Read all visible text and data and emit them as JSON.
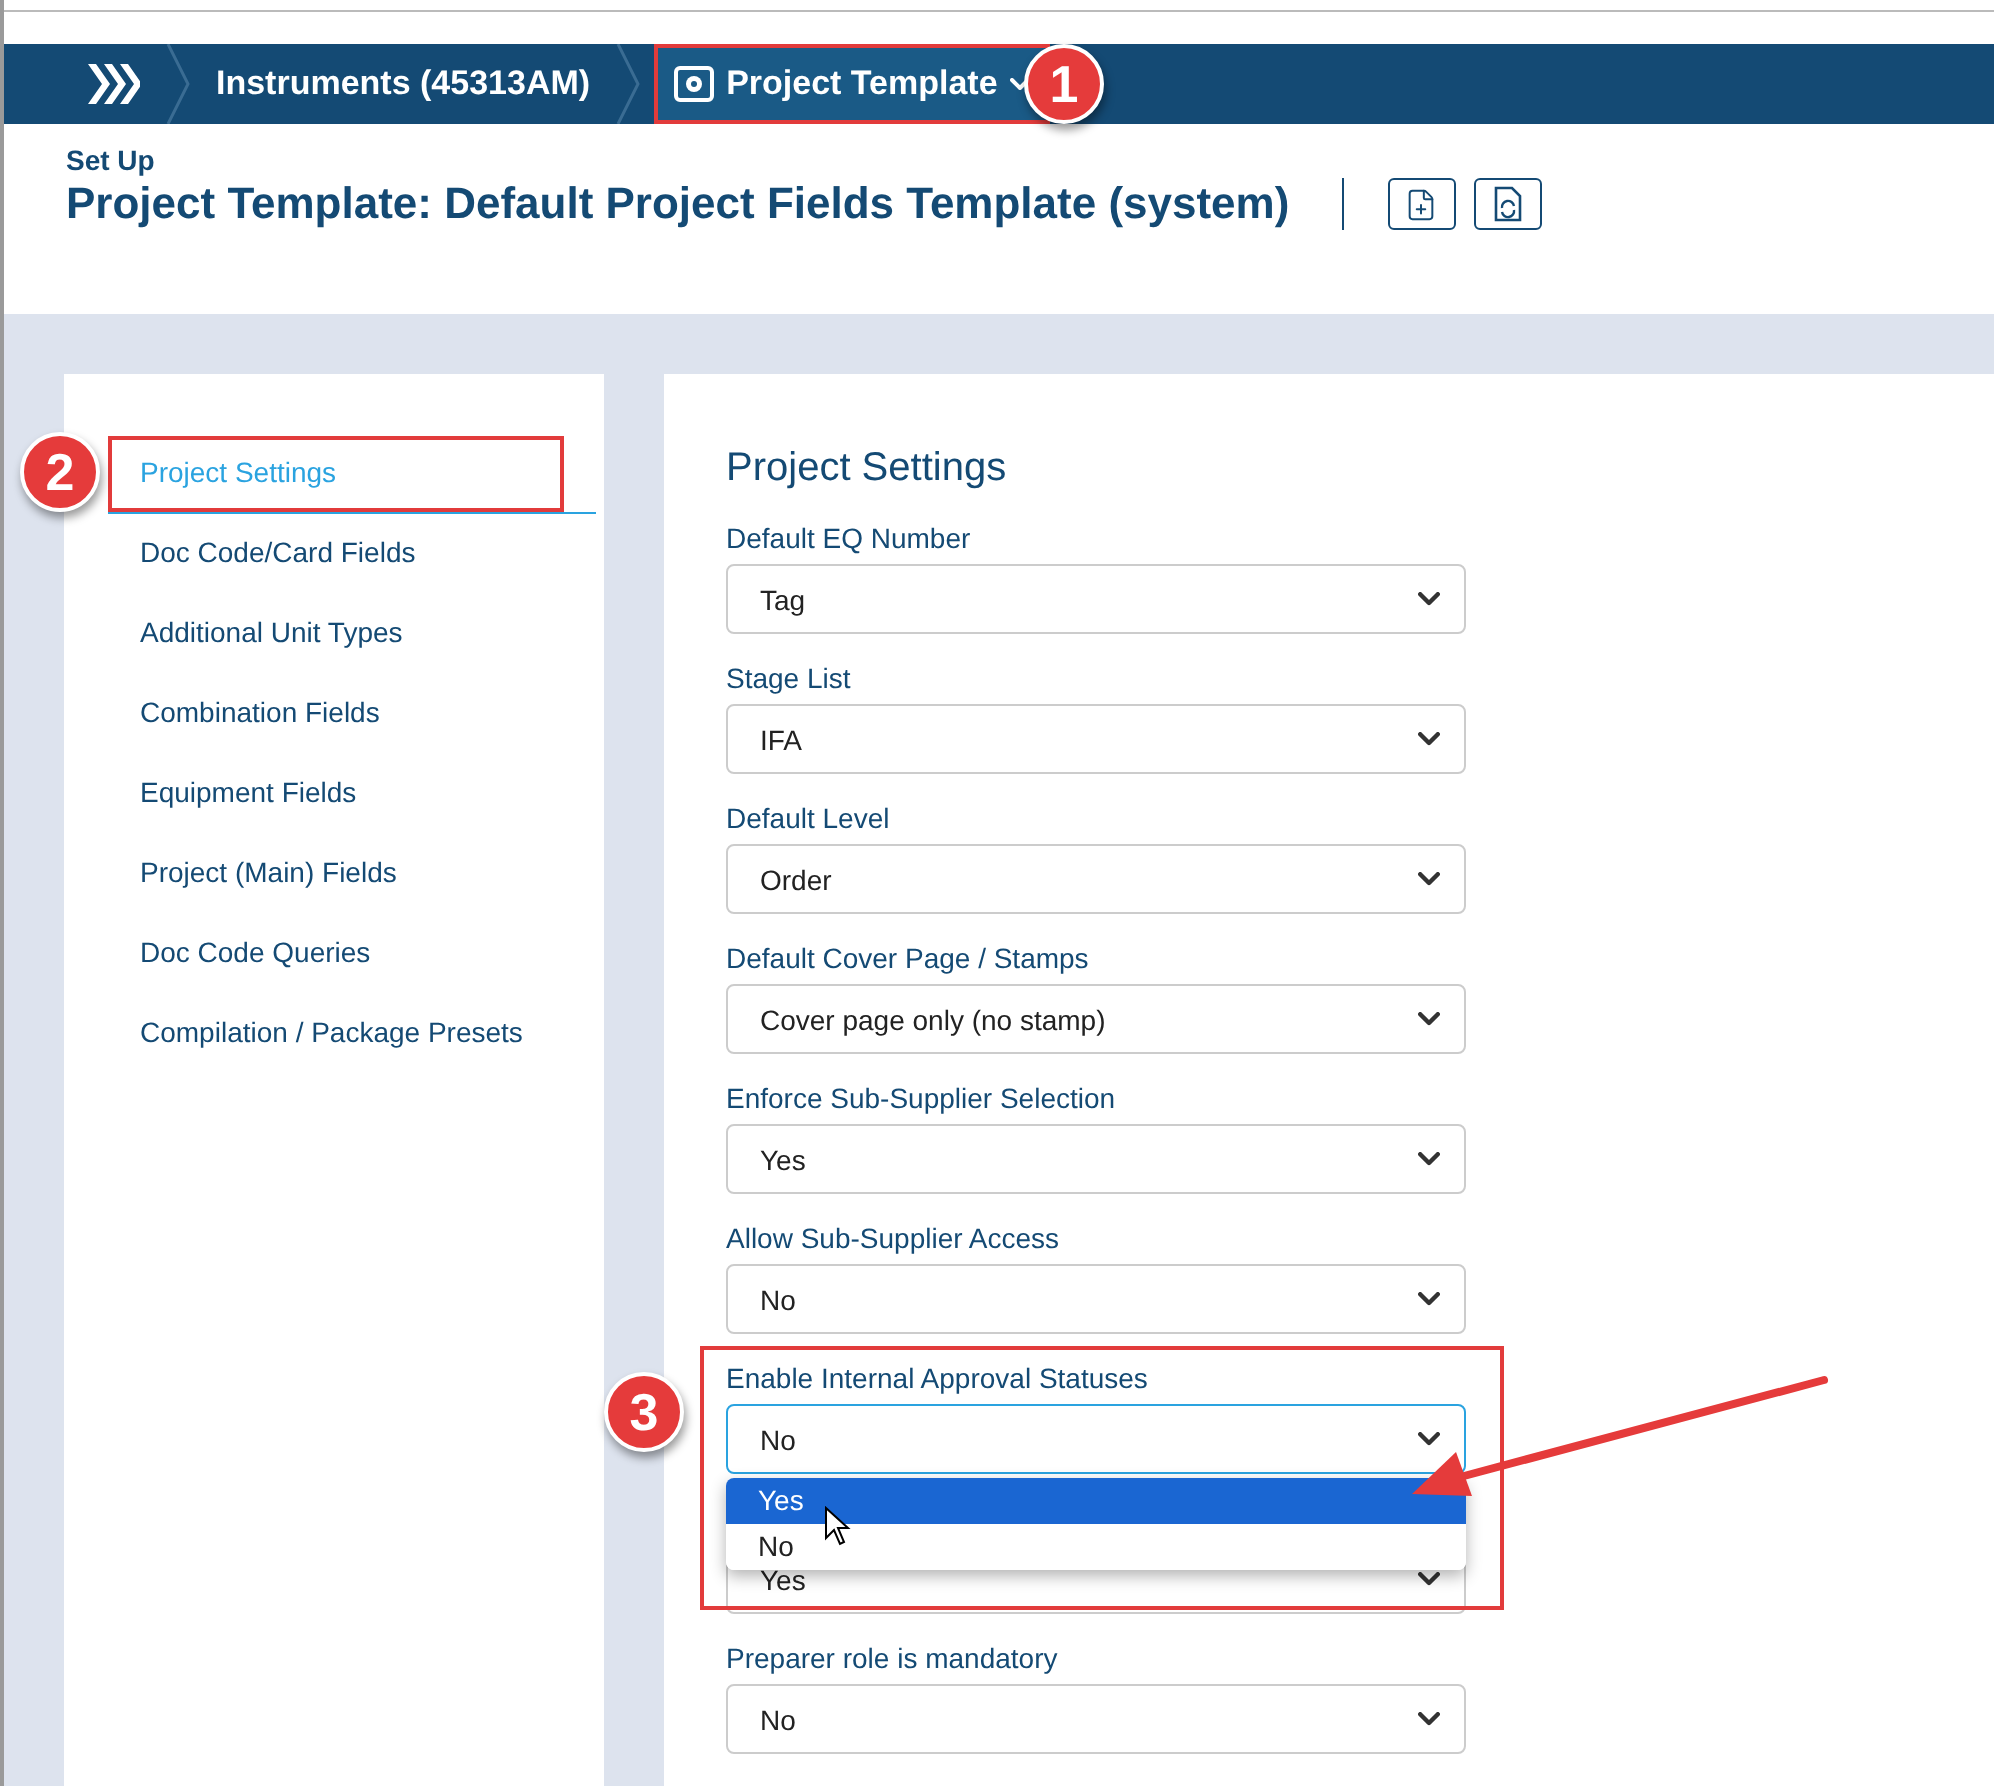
{
  "nav": {
    "crumbs": [
      {
        "kind": "home"
      },
      {
        "kind": "link",
        "label": "Instruments (45313AM)"
      },
      {
        "kind": "dropdown",
        "label": "Project Template"
      }
    ]
  },
  "header": {
    "section": "Set Up",
    "title": "Project Template: Default Project Fields Template (system)",
    "actions": [
      {
        "kind": "add"
      },
      {
        "kind": "refresh"
      }
    ]
  },
  "sidebar": {
    "items": [
      {
        "label": "Project Settings",
        "selected": true
      },
      {
        "label": "Doc Code/Card Fields",
        "selected": false
      },
      {
        "label": "Additional Unit Types",
        "selected": false
      },
      {
        "label": "Combination Fields",
        "selected": false
      },
      {
        "label": "Equipment Fields",
        "selected": false
      },
      {
        "label": "Project (Main) Fields",
        "selected": false
      },
      {
        "label": "Doc Code Queries",
        "selected": false
      },
      {
        "label": "Compilation / Package Presets",
        "selected": false
      }
    ]
  },
  "settings": {
    "title": "Project Settings",
    "fields": [
      {
        "label": "Default EQ Number",
        "value": "Tag",
        "open": false
      },
      {
        "label": "Stage List",
        "value": "IFA",
        "open": false
      },
      {
        "label": "Default Level",
        "value": "Order",
        "open": false
      },
      {
        "label": "Default Cover Page / Stamps",
        "value": "Cover page only (no stamp)",
        "open": false
      },
      {
        "label": "Enforce Sub-Supplier Selection",
        "value": "Yes",
        "open": false
      },
      {
        "label": "Allow Sub-Supplier Access",
        "value": "No",
        "open": false
      },
      {
        "label": "Enable Internal Approval Statuses",
        "value": "No",
        "open": true,
        "options": [
          {
            "label": "Yes",
            "highlighted": true
          },
          {
            "label": "No",
            "highlighted": false
          }
        ]
      },
      {
        "value": "Yes",
        "open": false
      },
      {
        "label": "Preparer role is mandatory",
        "value": "No",
        "open": false
      }
    ]
  },
  "annotations": {
    "callouts": [
      "1",
      "2",
      "3"
    ]
  }
}
